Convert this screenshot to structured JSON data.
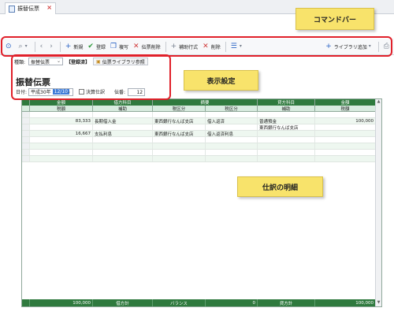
{
  "tab": {
    "label": "振替伝票",
    "close": "×"
  },
  "toolbar": {
    "new_label": "新規",
    "register_label": "登録",
    "copy_label": "複写",
    "delete_slip_label": "伝票削除",
    "add_line_label": "補助行式",
    "delete_label": "削除",
    "library_add_label": "ライブラリ追加"
  },
  "header": {
    "kind_label": "種類:",
    "kind_value": "振替伝票",
    "status": "【登録済】",
    "library_ref": "伝票ライブラリ参照",
    "title": "振替伝票",
    "date_label": "日付:",
    "era": "平成30年",
    "date_selected": "12/10",
    "closing_label": "決算仕訳",
    "slip_count_label": "伝番:",
    "slip_count": "12"
  },
  "grid": {
    "header1": [
      "",
      "金額",
      "借方科目",
      "",
      "摘要",
      "",
      "貸方科目",
      "金額"
    ],
    "header2": [
      "",
      "税額",
      "補助",
      "税区分",
      "",
      "税区分",
      "補助",
      "税額"
    ],
    "rows": [
      [
        "",
        "",
        "",
        "",
        "",
        "",
        "",
        ""
      ],
      [
        "",
        "83,333",
        "長期借入金",
        "東西銀行なんば支店",
        "借入返済",
        "",
        "普通預金",
        "100,000"
      ],
      [
        "",
        "",
        "",
        "",
        "",
        "",
        "東西銀行なんば支店",
        ""
      ],
      [
        "",
        "16,667",
        "支払利息",
        "東西銀行なんば支店",
        "借入返済利息",
        "",
        "",
        ""
      ],
      [
        "",
        "",
        "",
        "",
        "",
        "",
        "",
        ""
      ],
      [
        "",
        "",
        "",
        "",
        "",
        "",
        "",
        ""
      ],
      [
        "",
        "",
        "",
        "",
        "",
        "",
        "",
        ""
      ],
      [
        "",
        "",
        "",
        "",
        "",
        "",
        "",
        ""
      ]
    ],
    "footer": {
      "debit_total": "100,000",
      "debit_label": "借方計",
      "balance_label": "バランス",
      "balance_value": "0",
      "credit_label": "貸方計",
      "credit_total": "100,000"
    }
  },
  "annotations": {
    "command_bar": "コマンドバー",
    "display_settings": "表示設定",
    "journal_detail": "仕訳の明細"
  },
  "colors": {
    "grid_header": "#2f7a3e",
    "callout": "#f8e36b",
    "highlight": "#e0202a"
  }
}
